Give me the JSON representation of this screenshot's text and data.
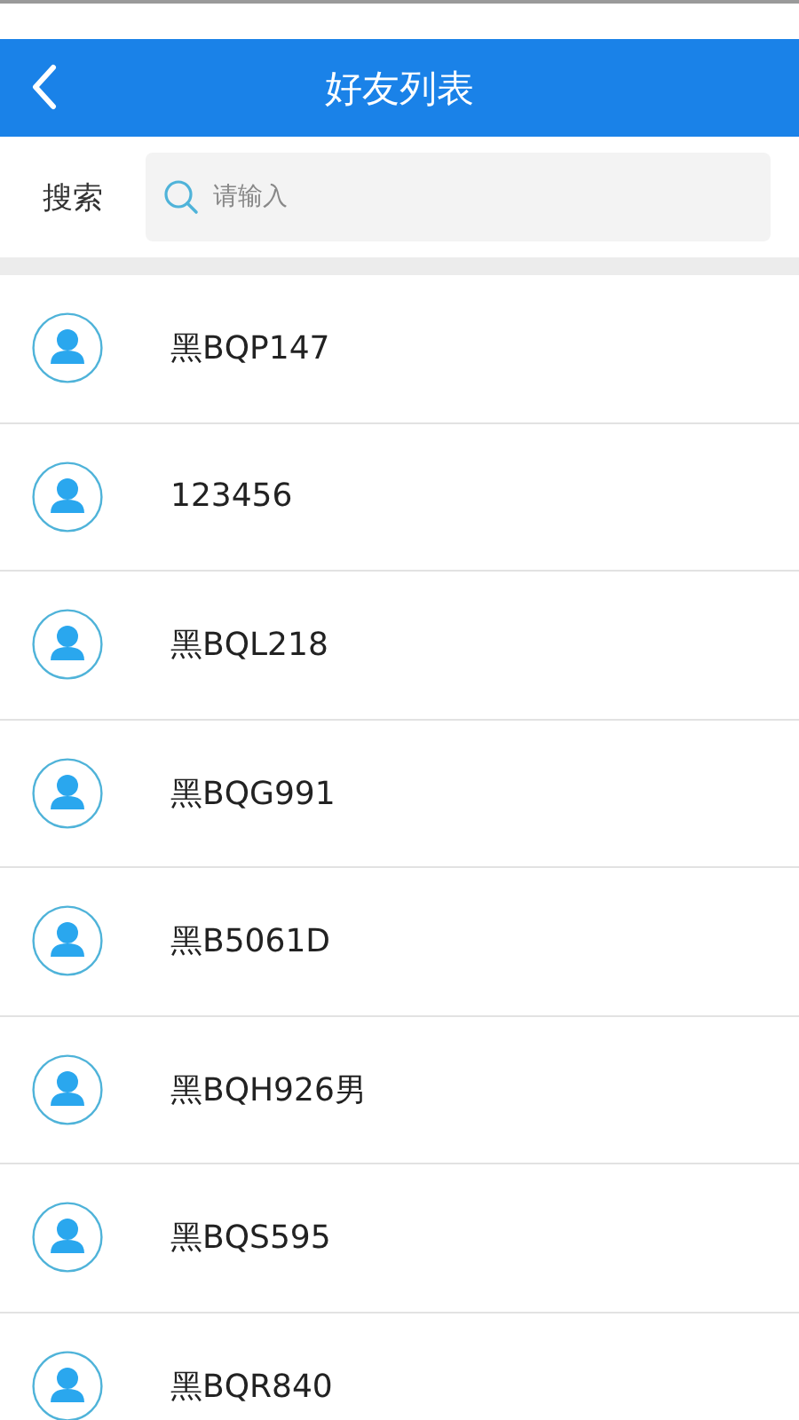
{
  "header": {
    "title": "好友列表"
  },
  "search": {
    "label": "搜索",
    "placeholder": "请输入"
  },
  "friends": [
    {
      "name": "黑BQP147"
    },
    {
      "name": "123456"
    },
    {
      "name": "黑BQL218"
    },
    {
      "name": "黑BQG991"
    },
    {
      "name": "黑B5061D"
    },
    {
      "name": "黑BQH926男"
    },
    {
      "name": "黑BQS595"
    },
    {
      "name": "黑BQR840"
    }
  ]
}
